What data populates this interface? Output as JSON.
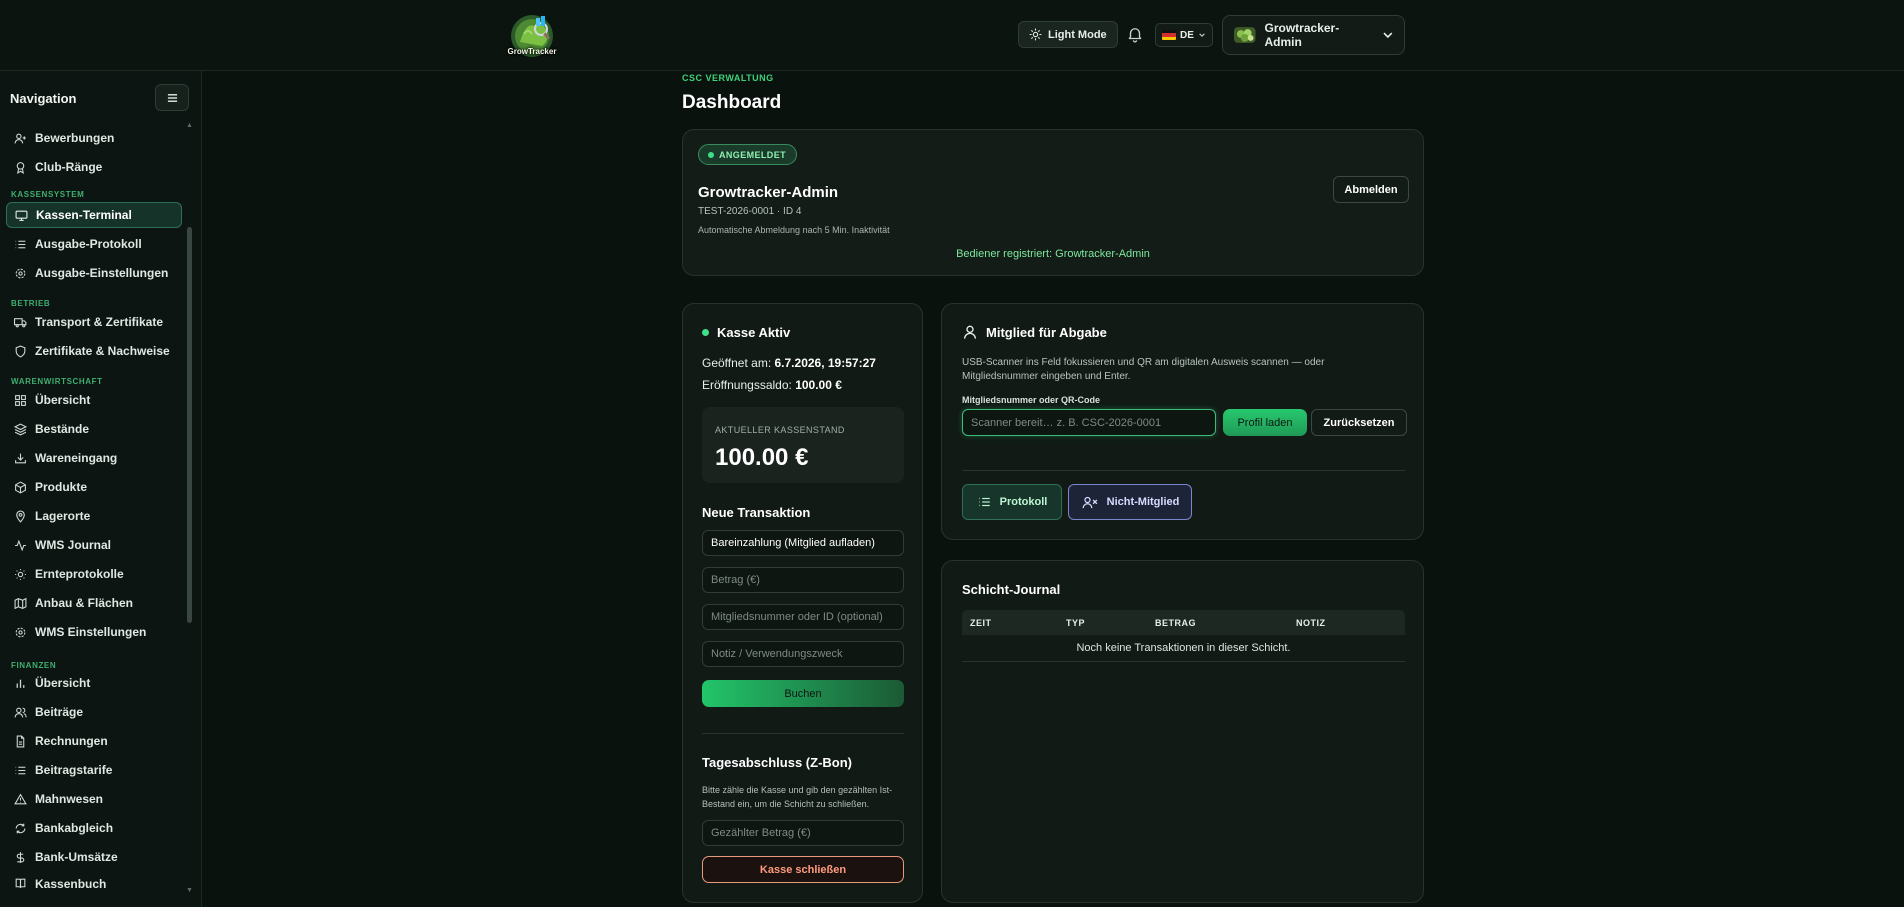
{
  "topbar": {
    "logo_text": "GrowTracker",
    "light_mode_label": "Light Mode",
    "language": "DE",
    "user_name": "Growtracker-Admin"
  },
  "sidebar": {
    "title": "Navigation",
    "sections": [
      {
        "label": "KASSENSYSTEM"
      },
      {
        "label": "BETRIEB"
      },
      {
        "label": "WARENWIRTSCHAFT"
      },
      {
        "label": "FINANZEN"
      }
    ],
    "items": [
      {
        "label": "Bewerbungen",
        "icon": "user-plus-icon"
      },
      {
        "label": "Club-Ränge",
        "icon": "award-icon"
      },
      {
        "label": "Kassen-Terminal",
        "icon": "monitor-icon",
        "active": true
      },
      {
        "label": "Ausgabe-Protokoll",
        "icon": "list-icon"
      },
      {
        "label": "Ausgabe-Einstellungen",
        "icon": "gear-icon"
      },
      {
        "label": "Transport & Zertifikate",
        "icon": "truck-icon"
      },
      {
        "label": "Zertifikate & Nachweise",
        "icon": "shield-icon"
      },
      {
        "label": "Übersicht",
        "icon": "grid-icon"
      },
      {
        "label": "Bestände",
        "icon": "layers-icon"
      },
      {
        "label": "Wareneingang",
        "icon": "download-icon"
      },
      {
        "label": "Produkte",
        "icon": "package-icon"
      },
      {
        "label": "Lagerorte",
        "icon": "map-pin-icon"
      },
      {
        "label": "WMS Journal",
        "icon": "activity-icon"
      },
      {
        "label": "Ernteprotokolle",
        "icon": "sun-icon"
      },
      {
        "label": "Anbau & Flächen",
        "icon": "map-icon"
      },
      {
        "label": "WMS Einstellungen",
        "icon": "gear-icon"
      },
      {
        "label": "Übersicht",
        "icon": "bar-chart-icon"
      },
      {
        "label": "Beiträge",
        "icon": "users-icon"
      },
      {
        "label": "Rechnungen",
        "icon": "file-icon"
      },
      {
        "label": "Beitragstarife",
        "icon": "list-icon"
      },
      {
        "label": "Mahnwesen",
        "icon": "alert-triangle-icon"
      },
      {
        "label": "Bankabgleich",
        "icon": "bank-sync-icon"
      },
      {
        "label": "Bank-Umsätze",
        "icon": "dollar-icon"
      },
      {
        "label": "Kassenbuch",
        "icon": "book-icon"
      }
    ]
  },
  "main": {
    "breadcrumb": "CSC VERWALTUNG",
    "title": "Dashboard",
    "session": {
      "badge": "ANGEMELDET",
      "name": "Growtracker-Admin",
      "id_line": "TEST-2026-0001 · ID 4",
      "note": "Automatische Abmeldung nach 5 Min. Inaktivität",
      "logout_label": "Abmelden",
      "operator": "Bediener registriert: Growtracker-Admin"
    },
    "kasse": {
      "status": "Kasse Aktiv",
      "opened_label": "Geöffnet am:",
      "opened_value": "6.7.2026, 19:57:27",
      "opening_label": "Eröffnungssaldo:",
      "opening_value": "100.00 €",
      "balance_label": "AKTUELLER KASSENSTAND",
      "balance_value": "100.00 €",
      "new_tx_title": "Neue Transaktion",
      "tx_type": "Bareinzahlung (Mitglied aufladen)",
      "amount_placeholder": "Betrag (€)",
      "member_placeholder": "Mitgliedsnummer oder ID (optional)",
      "note_placeholder": "Notiz / Verwendungszweck",
      "book_label": "Buchen",
      "zbon_title": "Tagesabschluss (Z-Bon)",
      "zbon_text": "Bitte zähle die Kasse und gib den gezählten Ist-Bestand ein, um die Schicht zu schließen.",
      "counted_placeholder": "Gezählter Betrag (€)",
      "close_label": "Kasse schließen"
    },
    "member": {
      "title": "Mitglied für Abgabe",
      "description": "USB-Scanner ins Feld fokussieren und QR am digitalen Ausweis scannen — oder Mitgliedsnummer eingeben und Enter.",
      "field_label": "Mitgliedsnummer oder QR-Code",
      "scan_placeholder": "Scanner bereit… z. B. CSC-2026-0001",
      "load_label": "Profil laden",
      "reset_label": "Zurücksetzen",
      "protocol_label": "Protokoll",
      "nonmember_label": "Nicht-Mitglied"
    },
    "journal": {
      "title": "Schicht-Journal",
      "columns": [
        "ZEIT",
        "TYP",
        "BETRAG",
        "NOTIZ"
      ],
      "empty": "Noch keine Transaktionen in dieser Schicht."
    }
  },
  "colors": {
    "accent": "#3fd07a",
    "background": "#0a120e",
    "danger": "#ff9b7d",
    "nonmember": "#7b86cc"
  }
}
